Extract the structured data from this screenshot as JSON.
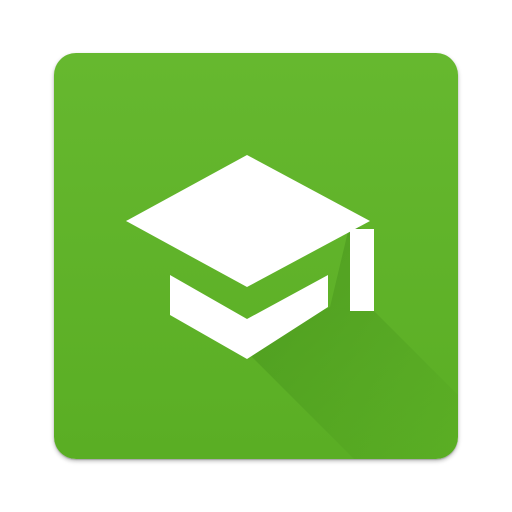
{
  "icon": {
    "name": "graduation-cap-icon",
    "background_color": "#5aae24",
    "background_highlight_color": "#66b82f",
    "long_shadow_color": "#3f8a18",
    "glyph_color": "#ffffff"
  }
}
